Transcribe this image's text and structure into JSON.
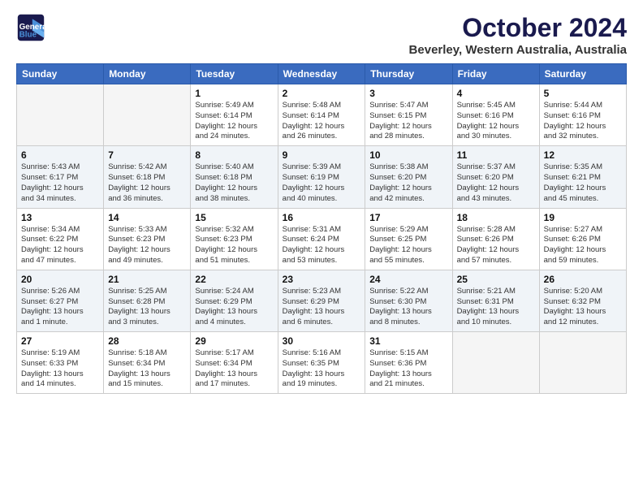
{
  "logo": {
    "line1": "General",
    "line2": "Blue"
  },
  "title": "October 2024",
  "subtitle": "Beverley, Western Australia, Australia",
  "days_of_week": [
    "Sunday",
    "Monday",
    "Tuesday",
    "Wednesday",
    "Thursday",
    "Friday",
    "Saturday"
  ],
  "weeks": [
    [
      {
        "day": "",
        "info": ""
      },
      {
        "day": "",
        "info": ""
      },
      {
        "day": "1",
        "info": "Sunrise: 5:49 AM\nSunset: 6:14 PM\nDaylight: 12 hours\nand 24 minutes."
      },
      {
        "day": "2",
        "info": "Sunrise: 5:48 AM\nSunset: 6:14 PM\nDaylight: 12 hours\nand 26 minutes."
      },
      {
        "day": "3",
        "info": "Sunrise: 5:47 AM\nSunset: 6:15 PM\nDaylight: 12 hours\nand 28 minutes."
      },
      {
        "day": "4",
        "info": "Sunrise: 5:45 AM\nSunset: 6:16 PM\nDaylight: 12 hours\nand 30 minutes."
      },
      {
        "day": "5",
        "info": "Sunrise: 5:44 AM\nSunset: 6:16 PM\nDaylight: 12 hours\nand 32 minutes."
      }
    ],
    [
      {
        "day": "6",
        "info": "Sunrise: 5:43 AM\nSunset: 6:17 PM\nDaylight: 12 hours\nand 34 minutes."
      },
      {
        "day": "7",
        "info": "Sunrise: 5:42 AM\nSunset: 6:18 PM\nDaylight: 12 hours\nand 36 minutes."
      },
      {
        "day": "8",
        "info": "Sunrise: 5:40 AM\nSunset: 6:18 PM\nDaylight: 12 hours\nand 38 minutes."
      },
      {
        "day": "9",
        "info": "Sunrise: 5:39 AM\nSunset: 6:19 PM\nDaylight: 12 hours\nand 40 minutes."
      },
      {
        "day": "10",
        "info": "Sunrise: 5:38 AM\nSunset: 6:20 PM\nDaylight: 12 hours\nand 42 minutes."
      },
      {
        "day": "11",
        "info": "Sunrise: 5:37 AM\nSunset: 6:20 PM\nDaylight: 12 hours\nand 43 minutes."
      },
      {
        "day": "12",
        "info": "Sunrise: 5:35 AM\nSunset: 6:21 PM\nDaylight: 12 hours\nand 45 minutes."
      }
    ],
    [
      {
        "day": "13",
        "info": "Sunrise: 5:34 AM\nSunset: 6:22 PM\nDaylight: 12 hours\nand 47 minutes."
      },
      {
        "day": "14",
        "info": "Sunrise: 5:33 AM\nSunset: 6:23 PM\nDaylight: 12 hours\nand 49 minutes."
      },
      {
        "day": "15",
        "info": "Sunrise: 5:32 AM\nSunset: 6:23 PM\nDaylight: 12 hours\nand 51 minutes."
      },
      {
        "day": "16",
        "info": "Sunrise: 5:31 AM\nSunset: 6:24 PM\nDaylight: 12 hours\nand 53 minutes."
      },
      {
        "day": "17",
        "info": "Sunrise: 5:29 AM\nSunset: 6:25 PM\nDaylight: 12 hours\nand 55 minutes."
      },
      {
        "day": "18",
        "info": "Sunrise: 5:28 AM\nSunset: 6:26 PM\nDaylight: 12 hours\nand 57 minutes."
      },
      {
        "day": "19",
        "info": "Sunrise: 5:27 AM\nSunset: 6:26 PM\nDaylight: 12 hours\nand 59 minutes."
      }
    ],
    [
      {
        "day": "20",
        "info": "Sunrise: 5:26 AM\nSunset: 6:27 PM\nDaylight: 13 hours\nand 1 minute."
      },
      {
        "day": "21",
        "info": "Sunrise: 5:25 AM\nSunset: 6:28 PM\nDaylight: 13 hours\nand 3 minutes."
      },
      {
        "day": "22",
        "info": "Sunrise: 5:24 AM\nSunset: 6:29 PM\nDaylight: 13 hours\nand 4 minutes."
      },
      {
        "day": "23",
        "info": "Sunrise: 5:23 AM\nSunset: 6:29 PM\nDaylight: 13 hours\nand 6 minutes."
      },
      {
        "day": "24",
        "info": "Sunrise: 5:22 AM\nSunset: 6:30 PM\nDaylight: 13 hours\nand 8 minutes."
      },
      {
        "day": "25",
        "info": "Sunrise: 5:21 AM\nSunset: 6:31 PM\nDaylight: 13 hours\nand 10 minutes."
      },
      {
        "day": "26",
        "info": "Sunrise: 5:20 AM\nSunset: 6:32 PM\nDaylight: 13 hours\nand 12 minutes."
      }
    ],
    [
      {
        "day": "27",
        "info": "Sunrise: 5:19 AM\nSunset: 6:33 PM\nDaylight: 13 hours\nand 14 minutes."
      },
      {
        "day": "28",
        "info": "Sunrise: 5:18 AM\nSunset: 6:34 PM\nDaylight: 13 hours\nand 15 minutes."
      },
      {
        "day": "29",
        "info": "Sunrise: 5:17 AM\nSunset: 6:34 PM\nDaylight: 13 hours\nand 17 minutes."
      },
      {
        "day": "30",
        "info": "Sunrise: 5:16 AM\nSunset: 6:35 PM\nDaylight: 13 hours\nand 19 minutes."
      },
      {
        "day": "31",
        "info": "Sunrise: 5:15 AM\nSunset: 6:36 PM\nDaylight: 13 hours\nand 21 minutes."
      },
      {
        "day": "",
        "info": ""
      },
      {
        "day": "",
        "info": ""
      }
    ]
  ]
}
